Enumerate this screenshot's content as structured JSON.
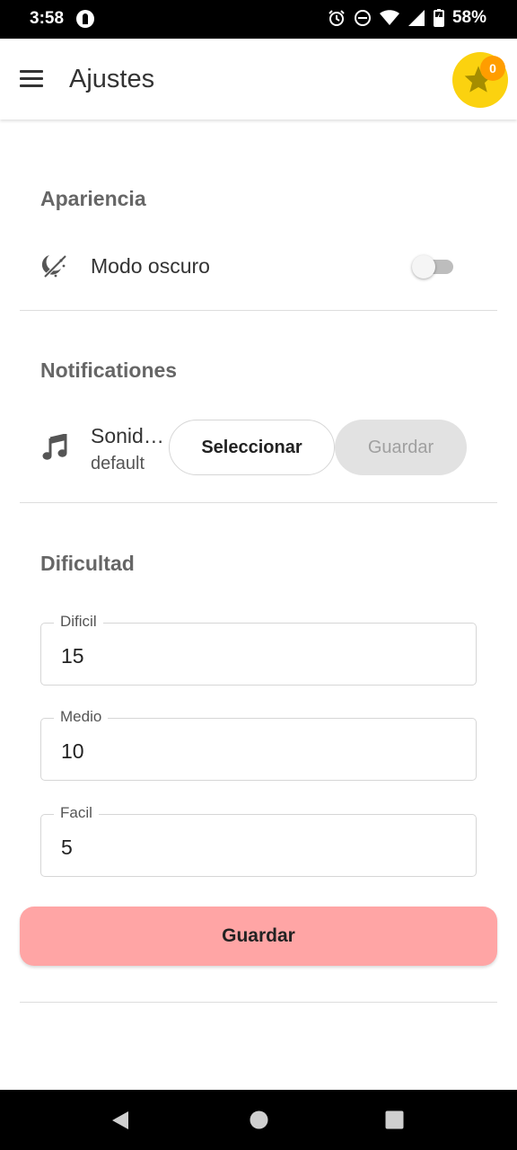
{
  "status_bar": {
    "time": "3:58",
    "battery": "58%",
    "icons": [
      "app-notification-icon",
      "alarm-icon",
      "do-not-disturb-icon",
      "wifi-icon",
      "signal-icon",
      "battery-charging-icon"
    ]
  },
  "app_bar": {
    "title": "Ajustes",
    "menu_icon": "menu-icon",
    "star_count": "0",
    "star_color": "#fbd20f",
    "badge_color": "#ff9d00"
  },
  "appearance": {
    "section_title": "Apariencia",
    "dark_mode_label": "Modo oscuro",
    "dark_mode_on": false,
    "icon": "theme-light-dark-icon"
  },
  "notifications": {
    "section_title": "Notificationes",
    "sound_title": "Sonid…",
    "sound_value": "default",
    "select_label": "Seleccionar",
    "save_label": "Guardar",
    "icon": "music-note-icon"
  },
  "difficulty": {
    "section_title": "Dificultad",
    "fields": [
      {
        "label": "Dificil",
        "value": "15"
      },
      {
        "label": "Medio",
        "value": "10"
      },
      {
        "label": "Facil",
        "value": "5"
      }
    ],
    "save_label": "Guardar",
    "save_color": "#ffa5a5"
  },
  "nav_bar": {
    "icons": [
      "back-icon",
      "home-icon",
      "recents-icon"
    ]
  }
}
